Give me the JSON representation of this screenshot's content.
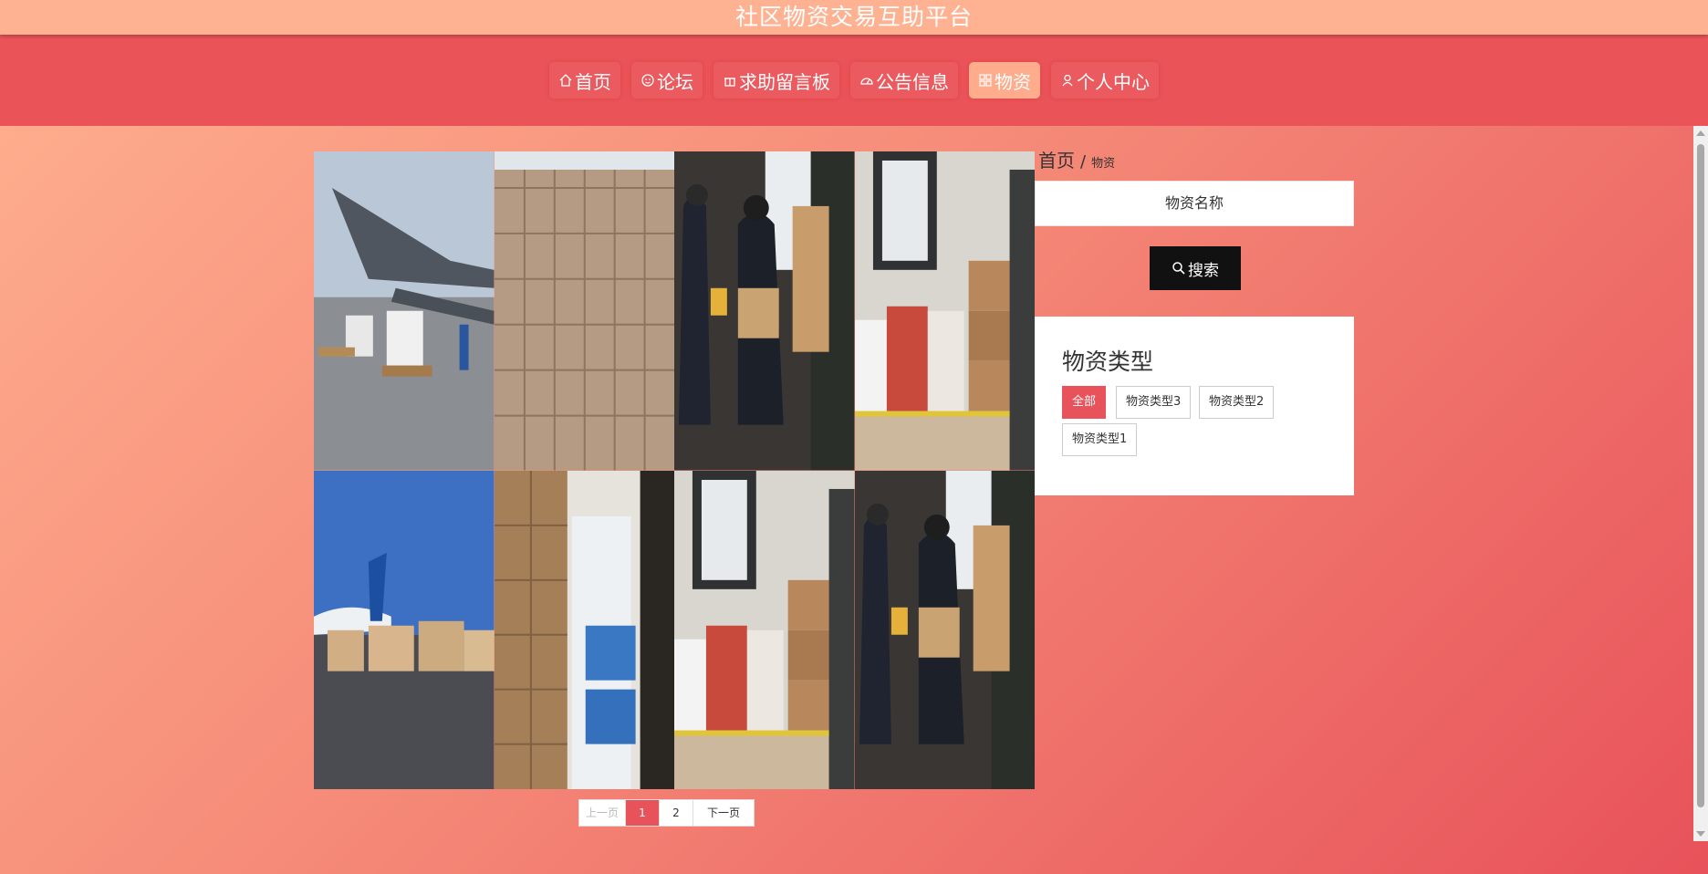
{
  "site": {
    "title": "社区物资交易互助平台"
  },
  "nav": {
    "items": [
      {
        "label": "首页",
        "icon": "home-icon"
      },
      {
        "label": "论坛",
        "icon": "smile-icon"
      },
      {
        "label": "求助留言板",
        "icon": "gift-icon"
      },
      {
        "label": "公告信息",
        "icon": "gauge-icon"
      },
      {
        "label": "物资",
        "icon": "grid-icon",
        "active": true
      },
      {
        "label": "个人中心",
        "icon": "user-icon"
      }
    ]
  },
  "breadcrumb": {
    "home": "首页",
    "separator": "/",
    "current": "物资"
  },
  "search": {
    "placeholder": "物资名称",
    "button_label": "搜索"
  },
  "categories": {
    "title": "物资类型",
    "items": [
      "全部",
      "物资类型3",
      "物资类型2",
      "物资类型1"
    ],
    "active_index": 0
  },
  "pagination": {
    "prev": "上一页",
    "pages": [
      "1",
      "2"
    ],
    "current": "1",
    "next": "下一页"
  },
  "colors": {
    "accent": "#e8525a",
    "nav_bg": "#ea5459",
    "topbar_bg": "#ffb292",
    "active_nav": "#ffac8c"
  }
}
